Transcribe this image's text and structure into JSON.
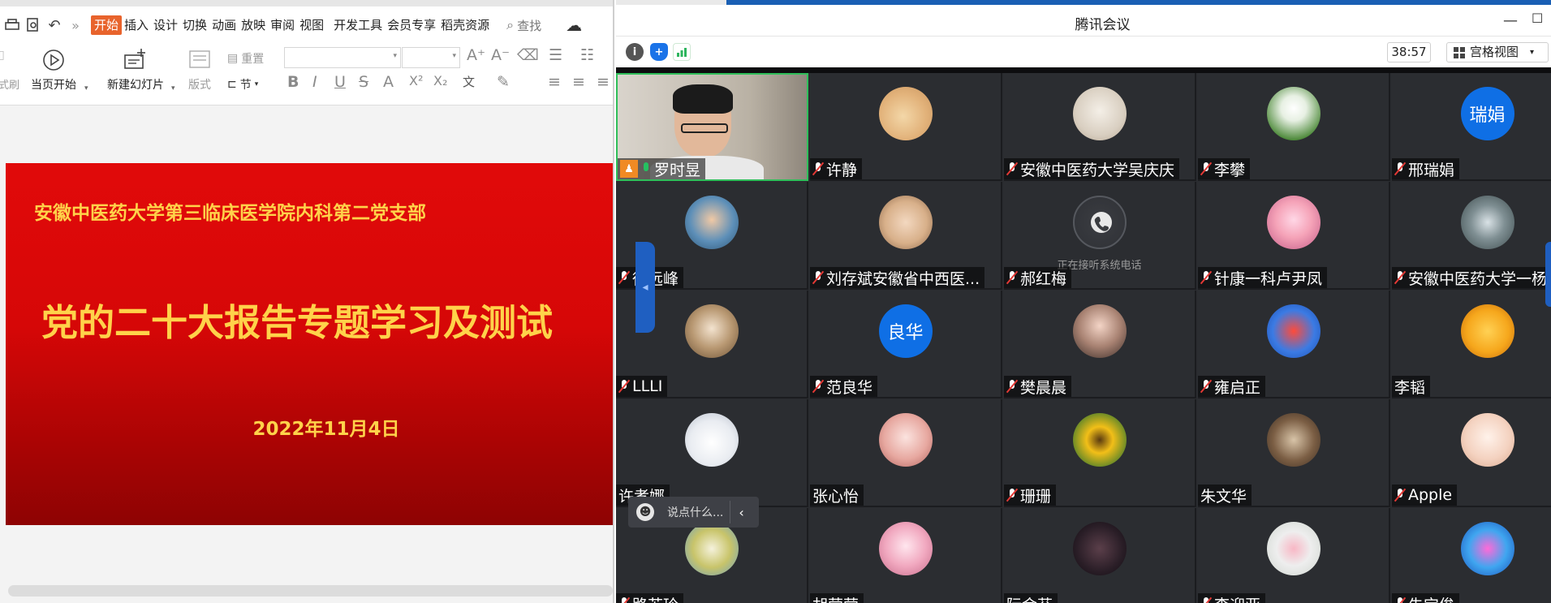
{
  "editor": {
    "quick_access": [
      "print-icon",
      "print-preview-icon",
      "undo-icon",
      "more-icon"
    ],
    "menu": {
      "tabs": [
        "开始",
        "插入",
        "设计",
        "切换",
        "动画",
        "放映",
        "审阅",
        "视图",
        "开发工具",
        "会员专享",
        "稻壳资源"
      ],
      "active_tab": "开始",
      "search_label": "查找"
    },
    "ribbon": {
      "play_from_current": "当页开始",
      "new_slide": "新建幻灯片",
      "layout": "版式",
      "reset": "重置",
      "section": "节",
      "format_painter_fragment": "式刷"
    },
    "slide": {
      "org_line": "安徽中医药大学第三临床医学院内科第二党支部",
      "title": "党的二十大报告专题学习及测试",
      "date": "2022年11月4日",
      "background_top": "#e10a0a",
      "text_color": "#ffd24a"
    }
  },
  "meeting": {
    "app_title": "腾讯会议",
    "timer": "38:57",
    "view_mode": "宫格视图",
    "chat_placeholder": "说点什么...",
    "phone_status": "正在接听系统电话",
    "tiles": [
      {
        "name": "罗时昱",
        "avatar": "video",
        "mic": "on",
        "host": true
      },
      {
        "name": "许静",
        "avatar": "cat-photo",
        "mic": "muted"
      },
      {
        "name": "安徽中医药大学吴庆庆",
        "avatar": "illustration-photo",
        "mic": "muted"
      },
      {
        "name": "李攀",
        "avatar": "flower-photo",
        "mic": "muted"
      },
      {
        "name": "邢瑞娟",
        "avatar": "text",
        "avatar_text": "瑞娟",
        "mic": "muted"
      },
      {
        "name": "徐远峰",
        "avatar": "child-photo",
        "mic": "muted"
      },
      {
        "name": "刘存斌安徽省中西医...",
        "avatar": "family-photo",
        "mic": "muted"
      },
      {
        "name": "郝红梅",
        "avatar": "phone",
        "mic": "muted",
        "phone": true
      },
      {
        "name": "针康一科卢尹凤",
        "avatar": "cartoon-photo",
        "mic": "muted"
      },
      {
        "name": "安徽中医药大学一杨",
        "avatar": "waterfall-photo",
        "mic": "muted"
      },
      {
        "name": "LLLI",
        "avatar": "toddler-photo",
        "mic": "muted"
      },
      {
        "name": "范良华",
        "avatar": "text",
        "avatar_text": "良华",
        "mic": "muted"
      },
      {
        "name": "樊晨晨",
        "avatar": "woman-photo",
        "mic": "muted"
      },
      {
        "name": "雍启正",
        "avatar": "cartoon-blue-photo",
        "mic": "muted"
      },
      {
        "name": "李韬",
        "avatar": "fight-photo",
        "mic": "none"
      },
      {
        "name": "许孝娜",
        "avatar": "girl-photo",
        "mic": "none"
      },
      {
        "name": "张心怡",
        "avatar": "woman2-photo",
        "mic": "none"
      },
      {
        "name": "珊珊",
        "avatar": "sunflower-photo",
        "mic": "muted"
      },
      {
        "name": "朱文华",
        "avatar": "street-photo",
        "mic": "none"
      },
      {
        "name": "Apple",
        "avatar": "baby-photo",
        "mic": "muted"
      },
      {
        "name": "路苏玲",
        "avatar": "pattern-photo",
        "mic": "muted"
      },
      {
        "name": "胡莹莹",
        "avatar": "flowers-photo",
        "mic": "none"
      },
      {
        "name": "阮金芬",
        "avatar": "dark-photo",
        "mic": "none"
      },
      {
        "name": "李迎亚",
        "avatar": "rose-photo",
        "mic": "muted"
      },
      {
        "name": "朱宝俊",
        "avatar": "fish-photo",
        "mic": "muted"
      }
    ]
  }
}
